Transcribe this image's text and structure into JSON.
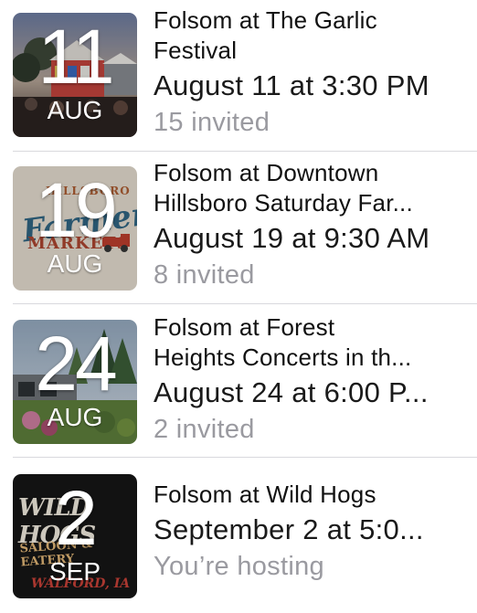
{
  "events": [
    {
      "day": "11",
      "month": "AUG",
      "title_line1": "Folsom at The Garlic",
      "title_line2": "Festival",
      "datetime": "August 11 at 3:30 PM",
      "status": "15 invited"
    },
    {
      "day": "19",
      "month": "AUG",
      "title_line1": "Folsom at Downtown",
      "title_line2": "Hillsboro Saturday Far...",
      "datetime": "August 19 at 9:30 AM",
      "status": "8 invited",
      "image_text": {
        "top": "HILLSBORO",
        "script": "Farmers'",
        "sub": "MARKETS"
      }
    },
    {
      "day": "24",
      "month": "AUG",
      "title_line1": "Folsom at Forest",
      "title_line2": "Heights Concerts in th...",
      "datetime": "August 24 at 6:00 P...",
      "status": "2 invited"
    },
    {
      "day": "2",
      "month": "SEP",
      "title_line1": "Folsom at Wild Hogs",
      "datetime": "September 2 at 5:0...",
      "status": "You’re hosting",
      "image_text": {
        "top": "WILD HOGS",
        "sub": "SALOON & EATERY",
        "town": "WALFORD, IA"
      }
    }
  ],
  "colors": {
    "primary_text": "#111111",
    "secondary_text": "#9a9aa0",
    "divider": "#d9d9dd"
  }
}
